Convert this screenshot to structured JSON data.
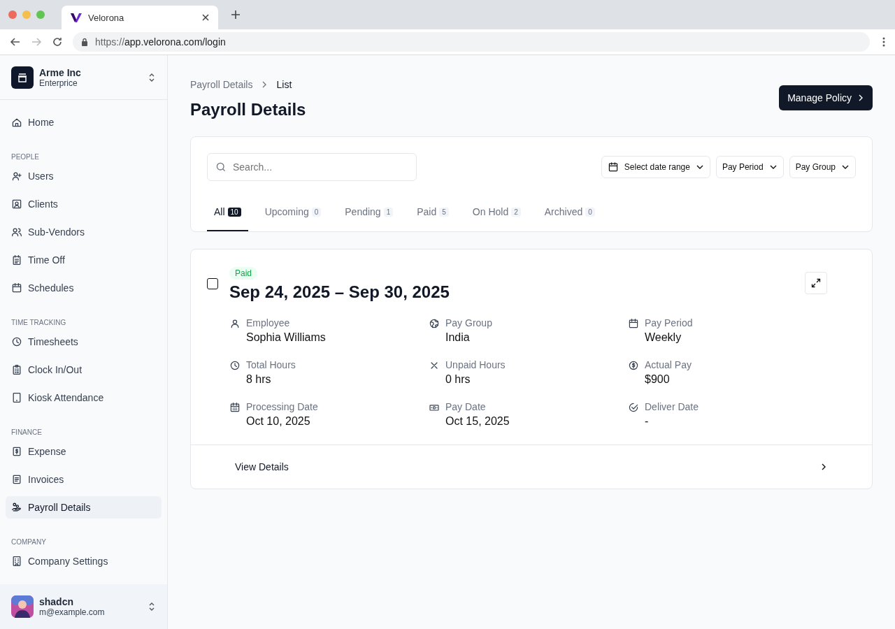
{
  "browser": {
    "tab_title": "Velorona",
    "url_prefix": "https://",
    "url_rest": "app.velorona.com/login"
  },
  "sidebar": {
    "org": {
      "name": "Arme Inc",
      "plan": "Enterprice"
    },
    "sections": [
      {
        "items": [
          {
            "label": "Home",
            "selected": false
          }
        ]
      },
      {
        "heading": "PEOPLE",
        "items": [
          {
            "label": "Users",
            "selected": false
          },
          {
            "label": "Clients",
            "selected": false
          },
          {
            "label": "Sub-Vendors",
            "selected": false
          },
          {
            "label": "Time Off",
            "selected": false
          },
          {
            "label": "Schedules",
            "selected": false
          }
        ]
      },
      {
        "heading": "TIME TRACKING",
        "items": [
          {
            "label": "Timesheets",
            "selected": false
          },
          {
            "label": "Clock In/Out",
            "selected": false
          },
          {
            "label": "Kiosk Attendance",
            "selected": false
          }
        ]
      },
      {
        "heading": "FINANCE",
        "items": [
          {
            "label": "Expense",
            "selected": false
          },
          {
            "label": "Invoices",
            "selected": false
          },
          {
            "label": "Payroll Details",
            "selected": true
          }
        ]
      },
      {
        "heading": "COMPANY",
        "items": [
          {
            "label": "Company Settings",
            "selected": false
          }
        ]
      }
    ],
    "user": {
      "name": "shadcn",
      "email": "m@example.com"
    }
  },
  "breadcrumb": [
    "Payroll Details",
    "List"
  ],
  "page_title": "Payroll Details",
  "primary_action": "Manage Policy",
  "search": {
    "placeholder": "Search..."
  },
  "filters": [
    {
      "label": "Select date range",
      "kind": "date"
    },
    {
      "label": "Pay Period",
      "kind": "select"
    },
    {
      "label": "Pay Group",
      "kind": "select"
    }
  ],
  "tabs": [
    {
      "label": "All",
      "count": "10",
      "selected": true
    },
    {
      "label": "Upcoming",
      "count": "0",
      "selected": false
    },
    {
      "label": "Pending",
      "count": "1",
      "selected": false
    },
    {
      "label": "Paid",
      "count": "5",
      "selected": false
    },
    {
      "label": "On Hold",
      "count": "2",
      "selected": false
    },
    {
      "label": "Archived",
      "count": "0",
      "selected": false
    }
  ],
  "payroll_card": {
    "checked": false,
    "status": "Paid",
    "title": "Sep 24, 2025 – Sep 30, 2025",
    "fields": [
      {
        "label": "Employee",
        "value": "Sophia Williams"
      },
      {
        "label": "Pay Group",
        "value": "India"
      },
      {
        "label": "Pay Period",
        "value": "Weekly"
      },
      {
        "label": "Total Hours",
        "value": "8 hrs"
      },
      {
        "label": "Unpaid Hours",
        "value": "0 hrs"
      },
      {
        "label": "Actual Pay",
        "value": "$900"
      },
      {
        "label": "Processing Date",
        "value": "Oct 10, 2025"
      },
      {
        "label": "Pay Date",
        "value": "Oct 15, 2025"
      },
      {
        "label": "Deliver Date",
        "value": "-"
      }
    ],
    "footer_link": "View Details"
  }
}
